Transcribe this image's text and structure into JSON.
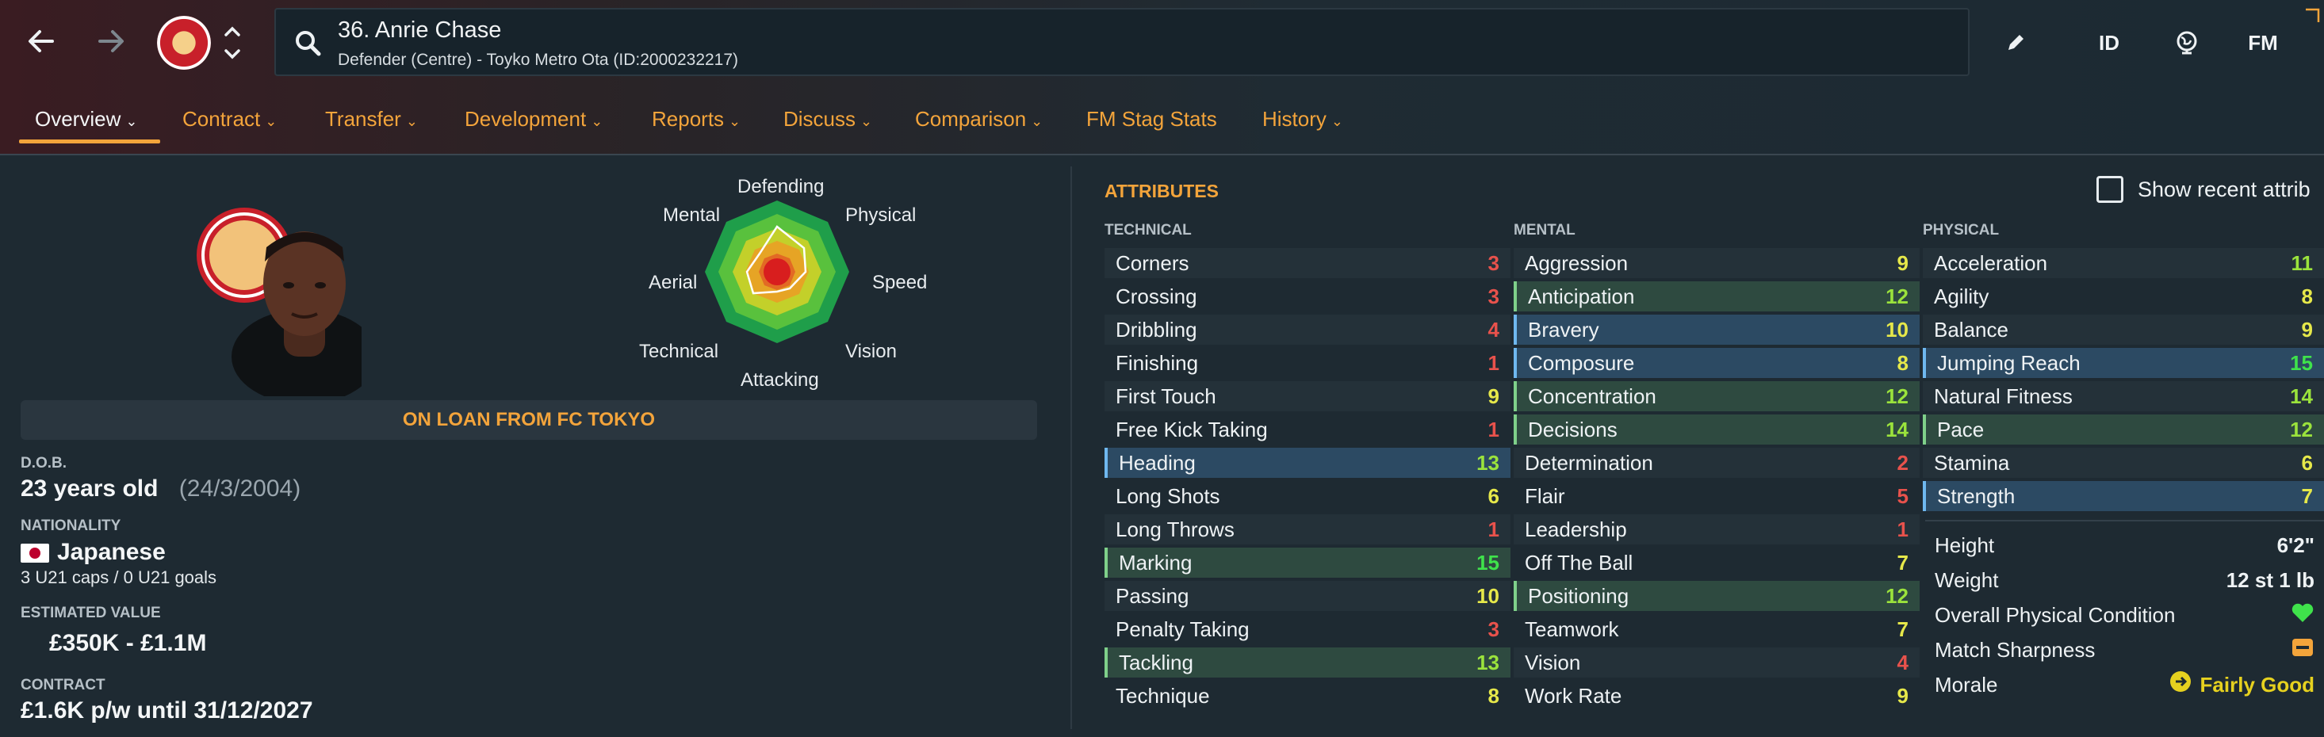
{
  "header": {
    "player_title": "36. Anrie Chase",
    "player_subtitle": "Defender (Centre) - Toyko Metro Ota (ID:2000232217)",
    "edit_icon": "pencil-icon",
    "id_label": "ID",
    "fm_label": "FM"
  },
  "tabs": [
    {
      "label": "Overview",
      "active": true
    },
    {
      "label": "Contract"
    },
    {
      "label": "Transfer"
    },
    {
      "label": "Development"
    },
    {
      "label": "Reports"
    },
    {
      "label": "Discuss"
    },
    {
      "label": "Comparison"
    },
    {
      "label": "FM Stag Stats"
    },
    {
      "label": "History"
    }
  ],
  "radar": {
    "labels": {
      "defending": "Defending",
      "physical": "Physical",
      "speed": "Speed",
      "vision": "Vision",
      "attacking": "Attacking",
      "technical": "Technical",
      "aerial": "Aerial",
      "mental": "Mental"
    }
  },
  "loan_banner": "ON LOAN FROM FC TOKYO",
  "info": {
    "dob_label": "D.O.B.",
    "age": "23 years old",
    "dob": "(24/3/2004)",
    "nationality_label": "NATIONALITY",
    "nationality": "Japanese",
    "caps": "3 U21 caps / 0 U21 goals",
    "value_label": "ESTIMATED VALUE",
    "value": "£350K - £1.1M",
    "contract_label": "CONTRACT",
    "contract": "£1.6K p/w until 31/12/2027"
  },
  "attributes": {
    "title": "ATTRIBUTES",
    "show_recent_label": "Show recent attrib",
    "technical_header": "TECHNICAL",
    "mental_header": "MENTAL",
    "physical_header": "PHYSICAL",
    "technical": [
      {
        "name": "Corners",
        "value": "3"
      },
      {
        "name": "Crossing",
        "value": "3"
      },
      {
        "name": "Dribbling",
        "value": "4"
      },
      {
        "name": "Finishing",
        "value": "1"
      },
      {
        "name": "First Touch",
        "value": "9"
      },
      {
        "name": "Free Kick Taking",
        "value": "1"
      },
      {
        "name": "Heading",
        "value": "13",
        "highlight": "blue"
      },
      {
        "name": "Long Shots",
        "value": "6"
      },
      {
        "name": "Long Throws",
        "value": "1"
      },
      {
        "name": "Marking",
        "value": "15",
        "highlight": "green"
      },
      {
        "name": "Passing",
        "value": "10"
      },
      {
        "name": "Penalty Taking",
        "value": "3"
      },
      {
        "name": "Tackling",
        "value": "13",
        "highlight": "green"
      },
      {
        "name": "Technique",
        "value": "8"
      }
    ],
    "mental": [
      {
        "name": "Aggression",
        "value": "9"
      },
      {
        "name": "Anticipation",
        "value": "12",
        "highlight": "green"
      },
      {
        "name": "Bravery",
        "value": "10",
        "highlight": "blue"
      },
      {
        "name": "Composure",
        "value": "8",
        "highlight": "blue"
      },
      {
        "name": "Concentration",
        "value": "12",
        "highlight": "green"
      },
      {
        "name": "Decisions",
        "value": "14",
        "highlight": "green"
      },
      {
        "name": "Determination",
        "value": "2"
      },
      {
        "name": "Flair",
        "value": "5"
      },
      {
        "name": "Leadership",
        "value": "1"
      },
      {
        "name": "Off The Ball",
        "value": "7"
      },
      {
        "name": "Positioning",
        "value": "12",
        "highlight": "green"
      },
      {
        "name": "Teamwork",
        "value": "7"
      },
      {
        "name": "Vision",
        "value": "4"
      },
      {
        "name": "Work Rate",
        "value": "9"
      }
    ],
    "physical": [
      {
        "name": "Acceleration",
        "value": "11"
      },
      {
        "name": "Agility",
        "value": "8"
      },
      {
        "name": "Balance",
        "value": "9"
      },
      {
        "name": "Jumping Reach",
        "value": "15",
        "highlight": "blue"
      },
      {
        "name": "Natural Fitness",
        "value": "14"
      },
      {
        "name": "Pace",
        "value": "12",
        "highlight": "green"
      },
      {
        "name": "Stamina",
        "value": "6"
      },
      {
        "name": "Strength",
        "value": "7",
        "highlight": "blue"
      }
    ],
    "physical_info": [
      {
        "name": "Height",
        "value": "6'2\""
      },
      {
        "name": "Weight",
        "value": "12 st 1 lb"
      },
      {
        "name": "Overall Physical Condition",
        "icon": "heart-icon"
      },
      {
        "name": "Match Sharpness",
        "icon": "sharpness-bar-icon"
      },
      {
        "name": "Morale",
        "value": "Fairly Good",
        "icon": "morale-arrow-icon"
      }
    ]
  },
  "colors": {
    "accent": "#f3a43b",
    "val_low": "#e8524c",
    "val_mid": "#e6e84a",
    "val_good": "#9be33c",
    "val_high": "#3fe24b"
  }
}
